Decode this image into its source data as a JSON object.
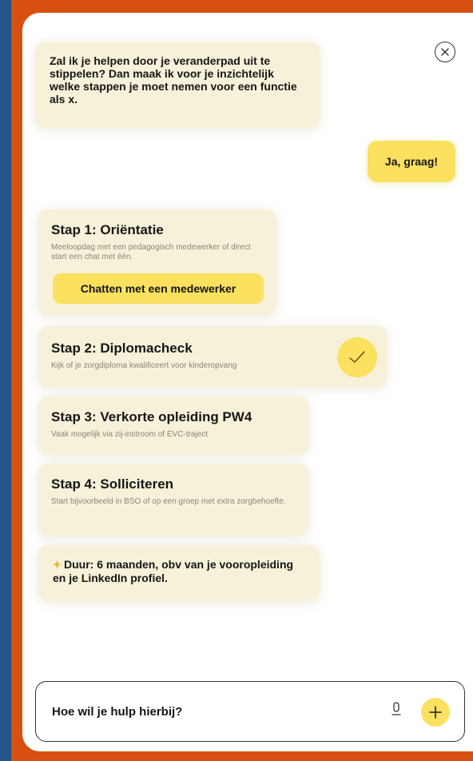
{
  "colors": {
    "background": "#24548a",
    "frame": "#d84f12",
    "bubble": "#f7f1d9",
    "accent": "#fbe15f"
  },
  "conversation": {
    "bot_intro": "Zal ik je helpen door je veranderpad uit te stippelen? Dan maak ik voor je inzichtelijk welke stappen je moet nemen voor een functie als x.",
    "user_reply": "Ja, graag!"
  },
  "steps": [
    {
      "title": "Stap 1: Oriëntatie",
      "description": "Meeloopdag met een pedagogisch medewerker of direct start een chat met één.",
      "button_label": "Chatten met een medewerker"
    },
    {
      "title": "Stap 2: Diplomacheck",
      "description": "Kijk of je zorgdiploma kwalificeert voor kinderopvang",
      "status_icon": "check-icon"
    },
    {
      "title": "Stap 3: Verkorte opleiding PW4",
      "description": "Vaak mogelijk via zij-instroom of EVC-traject"
    },
    {
      "title": "Stap 4: Solliciteren",
      "description": "Start bijvoorbeeld in BSO of op een groep met extra zorgbehoefte."
    }
  ],
  "duration": {
    "icon": "sparkle-icon",
    "text": "Duur: 6 maanden, obv van je vooropleiding en je LinkedIn profiel."
  },
  "composer": {
    "placeholder": "Hoe wil je hulp hierbij?",
    "mic_icon": "microphone-icon",
    "add_icon": "plus-icon"
  },
  "icons": {
    "close": "close-icon"
  }
}
